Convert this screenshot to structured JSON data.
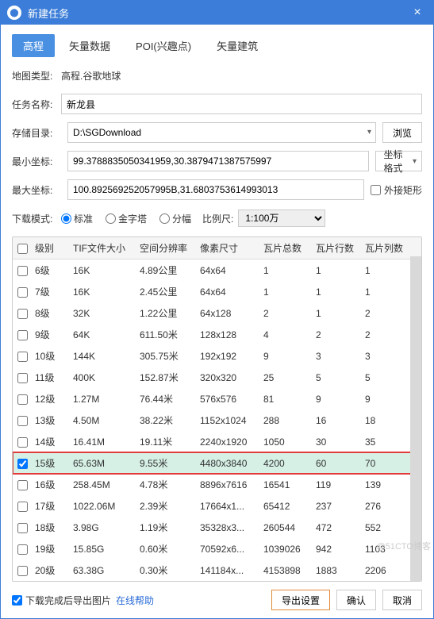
{
  "titlebar": {
    "title": "新建任务",
    "close": "×"
  },
  "tabs": [
    {
      "label": "高程",
      "active": true
    },
    {
      "label": "矢量数据",
      "active": false
    },
    {
      "label": "POI(兴趣点)",
      "active": false
    },
    {
      "label": "矢量建筑",
      "active": false
    }
  ],
  "map_type": {
    "label": "地图类型:",
    "value": "高程.谷歌地球"
  },
  "task_name": {
    "label": "任务名称:",
    "value": "新龙县"
  },
  "storage": {
    "label": "存储目录:",
    "value": "D:\\SGDownload",
    "browse": "浏览"
  },
  "min_coord": {
    "label": "最小坐标:",
    "value": "99.3788835050341959,30.3879471387575997",
    "format_btn": "坐标格式"
  },
  "max_coord": {
    "label": "最大坐标:",
    "value": "100.892569252057995B,31.6803753614993013",
    "rect_chk": "外接矩形"
  },
  "download_mode": {
    "label": "下载模式:",
    "options": [
      {
        "label": "标准",
        "checked": true
      },
      {
        "label": "金字塔",
        "checked": false
      },
      {
        "label": "分幅",
        "checked": false
      }
    ],
    "scale_label": "比例尺:",
    "scale_value": "1:100万"
  },
  "table": {
    "headers": [
      "级别",
      "TIF文件大小",
      "空间分辨率",
      "像素尺寸",
      "瓦片总数",
      "瓦片行数",
      "瓦片列数"
    ],
    "rows": [
      {
        "chk": false,
        "hl": false,
        "cells": [
          "6级",
          "16K",
          "4.89公里",
          "64x64",
          "1",
          "1",
          "1"
        ]
      },
      {
        "chk": false,
        "hl": false,
        "cells": [
          "7级",
          "16K",
          "2.45公里",
          "64x64",
          "1",
          "1",
          "1"
        ]
      },
      {
        "chk": false,
        "hl": false,
        "cells": [
          "8级",
          "32K",
          "1.22公里",
          "64x128",
          "2",
          "1",
          "2"
        ]
      },
      {
        "chk": false,
        "hl": false,
        "cells": [
          "9级",
          "64K",
          "611.50米",
          "128x128",
          "4",
          "2",
          "2"
        ]
      },
      {
        "chk": false,
        "hl": false,
        "cells": [
          "10级",
          "144K",
          "305.75米",
          "192x192",
          "9",
          "3",
          "3"
        ]
      },
      {
        "chk": false,
        "hl": false,
        "cells": [
          "11级",
          "400K",
          "152.87米",
          "320x320",
          "25",
          "5",
          "5"
        ]
      },
      {
        "chk": false,
        "hl": false,
        "cells": [
          "12级",
          "1.27M",
          "76.44米",
          "576x576",
          "81",
          "9",
          "9"
        ]
      },
      {
        "chk": false,
        "hl": false,
        "cells": [
          "13级",
          "4.50M",
          "38.22米",
          "1152x1024",
          "288",
          "16",
          "18"
        ]
      },
      {
        "chk": false,
        "hl": false,
        "cells": [
          "14级",
          "16.41M",
          "19.11米",
          "2240x1920",
          "1050",
          "30",
          "35"
        ]
      },
      {
        "chk": true,
        "hl": true,
        "cells": [
          "15级",
          "65.63M",
          "9.55米",
          "4480x3840",
          "4200",
          "60",
          "70"
        ]
      },
      {
        "chk": false,
        "hl": false,
        "cells": [
          "16级",
          "258.45M",
          "4.78米",
          "8896x7616",
          "16541",
          "119",
          "139"
        ]
      },
      {
        "chk": false,
        "hl": false,
        "cells": [
          "17级",
          "1022.06M",
          "2.39米",
          "17664x1...",
          "65412",
          "237",
          "276"
        ]
      },
      {
        "chk": false,
        "hl": false,
        "cells": [
          "18级",
          "3.98G",
          "1.19米",
          "35328x3...",
          "260544",
          "472",
          "552"
        ]
      },
      {
        "chk": false,
        "hl": false,
        "cells": [
          "19级",
          "15.85G",
          "0.60米",
          "70592x6...",
          "1039026",
          "942",
          "1103"
        ]
      },
      {
        "chk": false,
        "hl": false,
        "cells": [
          "20级",
          "63.38G",
          "0.30米",
          "141184x...",
          "4153898",
          "1883",
          "2206"
        ]
      }
    ]
  },
  "footer": {
    "export_img_chk": "下载完成后导出图片",
    "help_link": "在线帮助",
    "export_settings": "导出设置",
    "ok": "确认",
    "cancel": "取消"
  },
  "watermark": "@51CTO博客"
}
